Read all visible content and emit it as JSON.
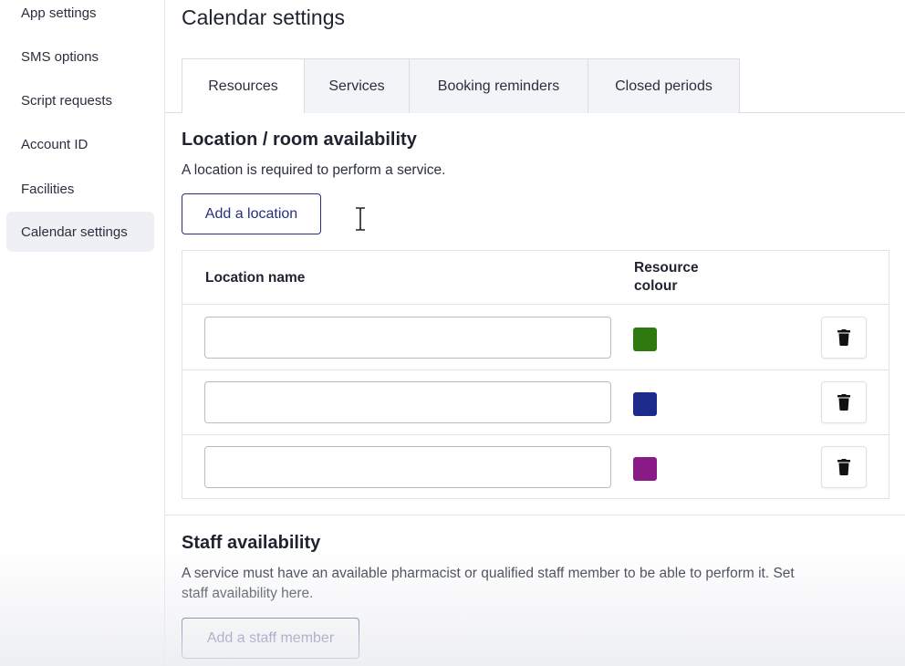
{
  "sidebar": {
    "items": [
      {
        "label": "App settings",
        "active": false
      },
      {
        "label": "SMS options",
        "active": false
      },
      {
        "label": "Script requests",
        "active": false
      },
      {
        "label": "Account ID",
        "active": false
      },
      {
        "label": "Facilities",
        "active": false
      },
      {
        "label": "Calendar settings",
        "active": true
      }
    ]
  },
  "page": {
    "title": "Calendar settings"
  },
  "tabs": [
    {
      "label": "Resources",
      "active": true
    },
    {
      "label": "Services",
      "active": false
    },
    {
      "label": "Booking reminders",
      "active": false
    },
    {
      "label": "Closed periods",
      "active": false
    }
  ],
  "locations": {
    "title": "Location / room availability",
    "description": "A location is required to perform a service.",
    "add_button": "Add a location",
    "columns": {
      "name": "Location name",
      "colour": "Resource colour"
    },
    "rows": [
      {
        "name": "",
        "colour": "#2f7a0e",
        "delete_icon": "trash-icon"
      },
      {
        "name": "",
        "colour": "#1c2a8c",
        "delete_icon": "trash-icon"
      },
      {
        "name": "",
        "colour": "#8a1a86",
        "delete_icon": "trash-icon"
      }
    ]
  },
  "staff": {
    "title": "Staff availability",
    "description": "A service must have an available pharmacist or qualified staff member to be able to perform it. Set staff availability here.",
    "add_button": "Add a staff member"
  },
  "colors": {
    "accent": "#27307a",
    "active_nav_bg": "#eef0f6"
  },
  "cursor": "text-cursor-icon"
}
